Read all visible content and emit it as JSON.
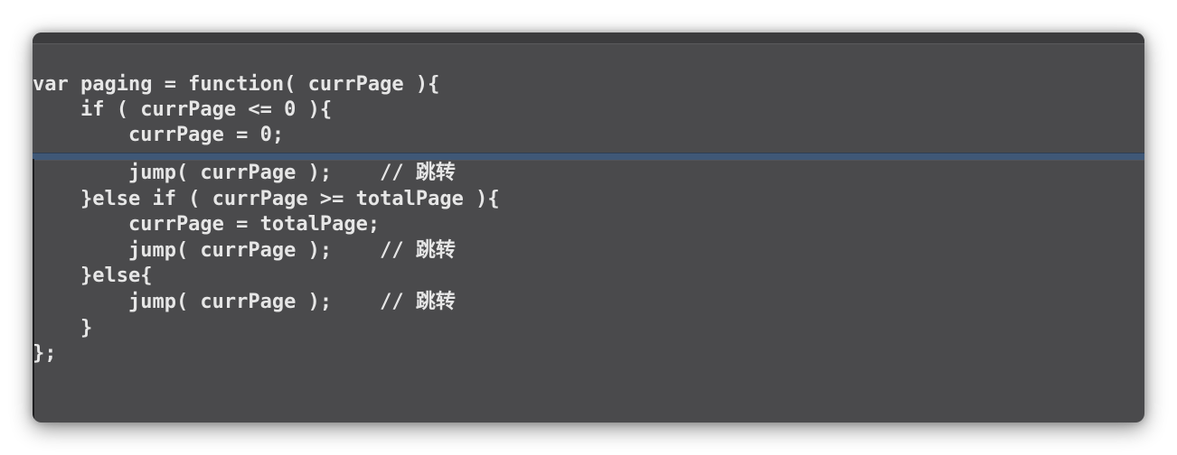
{
  "code": {
    "lines_top": [
      "var paging = function( currPage ){",
      "    if ( currPage <= 0 ){",
      "        currPage = 0;"
    ],
    "lines_bottom": [
      "        jump( currPage );    // 跳转",
      "    }else if ( currPage >= totalPage ){",
      "        currPage = totalPage;",
      "        jump( currPage );    // 跳转",
      "    }else{",
      "        jump( currPage );    // 跳转",
      "    }",
      "};"
    ]
  },
  "colors": {
    "background": "#4a4a4c",
    "text": "#e6e6e6",
    "split_line": "#3f5877"
  }
}
